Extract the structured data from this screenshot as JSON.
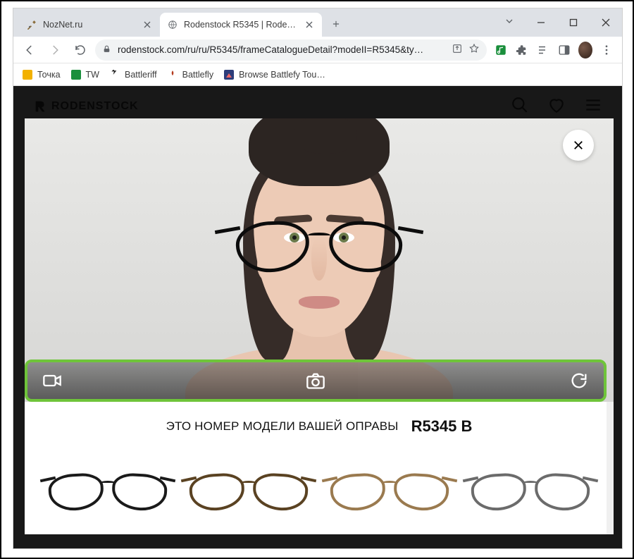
{
  "window": {
    "tabs": [
      {
        "title": "NozNet.ru",
        "active": false
      },
      {
        "title": "Rodenstock R5345 | Rodenstock",
        "active": true
      }
    ]
  },
  "omnibox": {
    "url": "rodenstock.com/ru/ru/R5345/frameCatalogueDetail?modeII=R5345&ty…"
  },
  "bookmarks": [
    {
      "label": "Точка",
      "color": "#f2b100"
    },
    {
      "label": "TW",
      "color": "#1a8f3c"
    },
    {
      "label": "Battleriff",
      "color": "#222"
    },
    {
      "label": "Battlefly",
      "color": "#b43a1e"
    },
    {
      "label": "Browse Battlefy Tou…",
      "color": "#3e5fb5"
    }
  ],
  "site": {
    "brand": "RODENSTOCK"
  },
  "tryon": {
    "icons": {
      "video": "video-icon",
      "camera": "camera-icon",
      "reload": "reload-icon",
      "close": "close-icon"
    }
  },
  "model": {
    "label": "ЭТО НОМЕР МОДЕЛИ ВАШЕЙ ОПРАВЫ",
    "code": "R5345 B"
  },
  "variants": [
    {
      "color": "#1a1a1a"
    },
    {
      "color": "#5a4222"
    },
    {
      "color": "#9a7a4f"
    },
    {
      "color": "#6b6b6b"
    }
  ]
}
